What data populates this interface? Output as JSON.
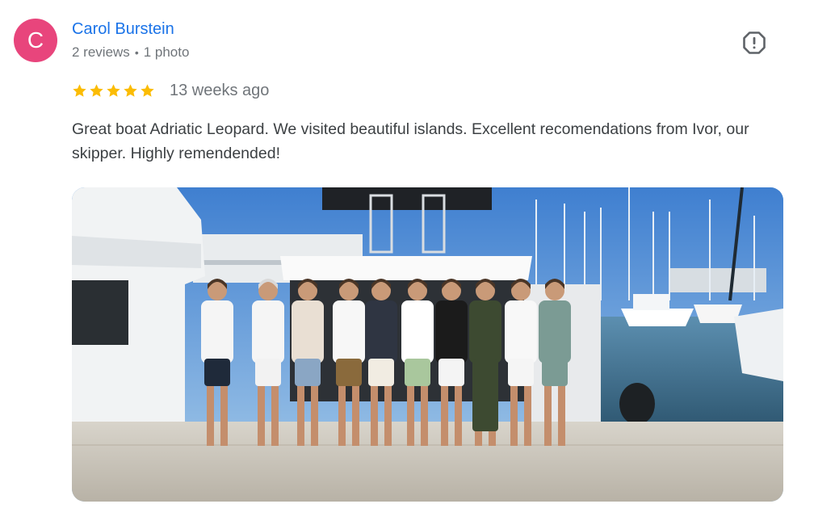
{
  "review": {
    "avatar_letter": "C",
    "avatar_color": "#e8457c",
    "reviewer_name": "Carol Burstein",
    "reviews_count": "2 reviews",
    "separator": "•",
    "photos_count": "1 photo",
    "rating": 5,
    "max_rating": 5,
    "time_ago": "13 weeks ago",
    "text": "Great boat Adriatic Leopard. We visited beautiful islands. Excellent recomendations from Ivor, our skipper. Highly remendended!",
    "star_color": "#fbbc04",
    "name_color": "#1a73e8"
  },
  "icons": {
    "report": "report-flag-icon",
    "star": "star-icon"
  }
}
